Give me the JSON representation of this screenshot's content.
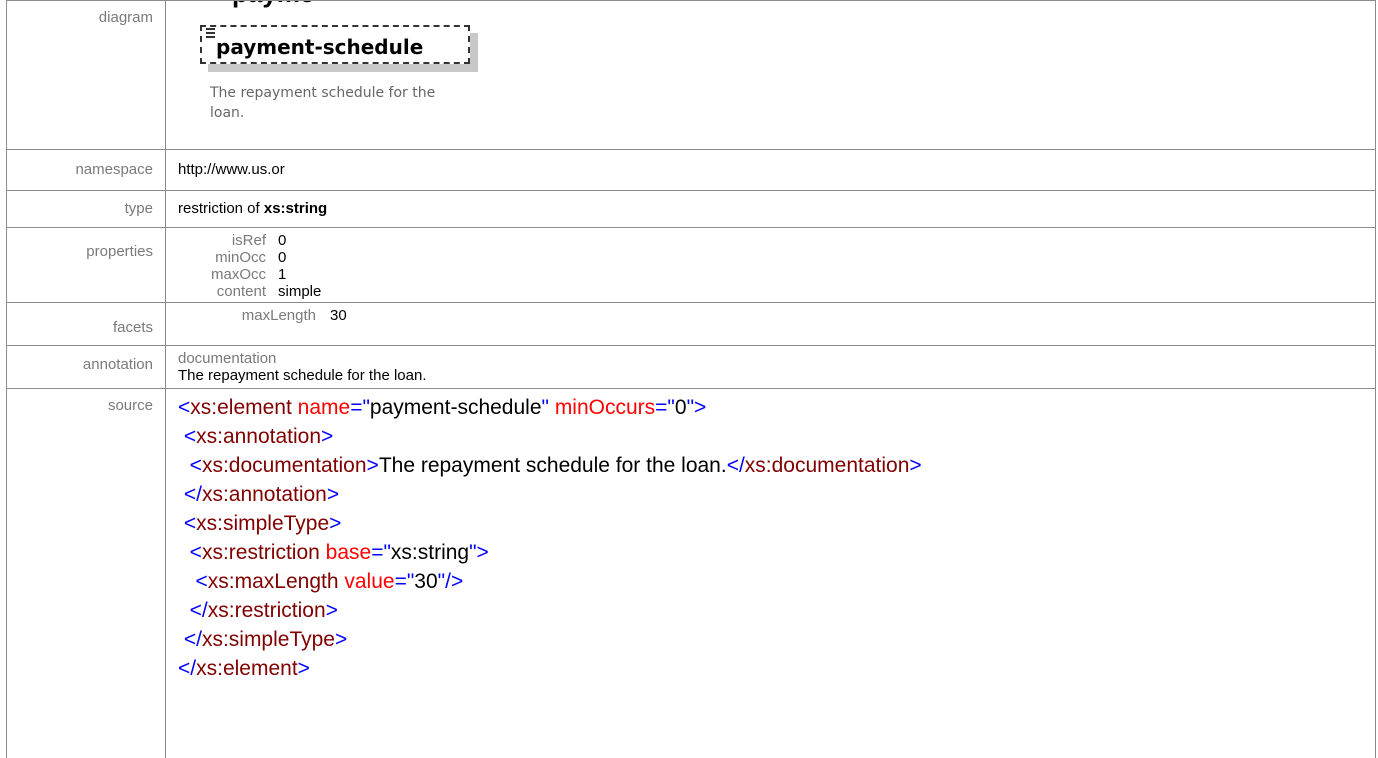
{
  "title_fragment": "payme",
  "rows": {
    "diagram": {
      "label": "diagram",
      "element_name": "payment-schedule",
      "description": "The repayment schedule for the loan."
    },
    "namespace": {
      "label": "namespace",
      "value": "http://www.us.or"
    },
    "type": {
      "label": "type",
      "prefix": "restriction of ",
      "base": "xs:string"
    },
    "properties": {
      "label": "properties",
      "items": [
        {
          "key": "isRef",
          "value": "0"
        },
        {
          "key": "minOcc",
          "value": "0"
        },
        {
          "key": "maxOcc",
          "value": "1"
        },
        {
          "key": "content",
          "value": "simple"
        }
      ]
    },
    "facets": {
      "label": "facets",
      "items": [
        {
          "key": "maxLength",
          "value": "30"
        }
      ]
    },
    "annotation": {
      "label": "annotation",
      "sub_label": "documentation",
      "text": "The repayment schedule for the loan."
    },
    "source": {
      "label": "source",
      "lines": [
        [
          "<",
          "xs:element",
          " ",
          "name",
          "=\"",
          "payment-schedule",
          "\" ",
          "minOccurs",
          "=\"",
          "0",
          "\">"
        ],
        [
          " <",
          "xs:annotation",
          ">"
        ],
        [
          "  <",
          "xs:documentation",
          ">",
          "The repayment schedule for the loan.",
          "</",
          "xs:documentation",
          ">"
        ],
        [
          " </",
          "xs:annotation",
          ">"
        ],
        [
          " <",
          "xs:simpleType",
          ">"
        ],
        [
          "  <",
          "xs:restriction",
          " ",
          "base",
          "=\"",
          "xs:string",
          "\">"
        ],
        [
          "   <",
          "xs:maxLength",
          " ",
          "value",
          "=\"",
          "30",
          "\"/>"
        ],
        [
          "  </",
          "xs:restriction",
          ">"
        ],
        [
          " </",
          "xs:simpleType",
          ">"
        ],
        [
          "</",
          "xs:element",
          ">"
        ]
      ]
    }
  },
  "colors": {
    "tag": "#0000ff",
    "name": "#800000",
    "attr": "#ff0000",
    "label": "#7a7a7a",
    "border": "#8c8c8c"
  }
}
